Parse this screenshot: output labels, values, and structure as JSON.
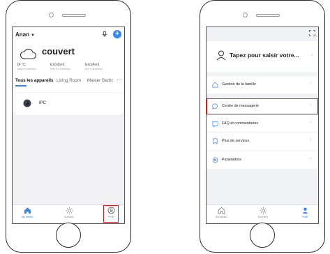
{
  "left_screen": {
    "home_name": "Anan",
    "weather": {
      "condition": "couvert",
      "stats": [
        {
          "value": "24 °C",
          "label": "Temp à l'extérieur"
        },
        {
          "value": "Excellent",
          "label": "PM2.5 à l'extérieur"
        },
        {
          "value": "Excellent",
          "label": "AQI à l'extérieur"
        }
      ]
    },
    "tabs": [
      "Tous les appareils",
      "Living Room",
      "Master Bedro"
    ],
    "devices": [
      {
        "name": "IPC"
      }
    ],
    "tabbar": [
      {
        "label": "Ma famille",
        "icon": "home-icon",
        "active": true
      },
      {
        "label": "Scénario",
        "icon": "scene-sun-icon",
        "active": false
      },
      {
        "label": "Profil",
        "icon": "profile-icon",
        "active": false
      }
    ]
  },
  "right_screen": {
    "profile_prompt": "Tapez pour saisir votre...",
    "menu_groups": [
      [
        {
          "label": "Gestion de la famille",
          "icon": "home-outline-icon"
        }
      ],
      [
        {
          "label": "Centre de messagerie",
          "icon": "message-icon"
        },
        {
          "label": "FAQ et commentaires",
          "icon": "feedback-icon"
        },
        {
          "label": "Plus de services",
          "icon": "bookmark-icon"
        }
      ],
      [
        {
          "label": "Paramètres",
          "icon": "settings-icon"
        }
      ]
    ],
    "tabbar": [
      {
        "label": "Ma famille",
        "icon": "home-outline-icon",
        "active": false
      },
      {
        "label": "Scénario",
        "icon": "scene-sun-icon",
        "active": false
      },
      {
        "label": "Profil",
        "icon": "profile-icon",
        "active": true
      }
    ]
  },
  "colors": {
    "accent": "#3a86e8",
    "highlight": "#d62020"
  }
}
